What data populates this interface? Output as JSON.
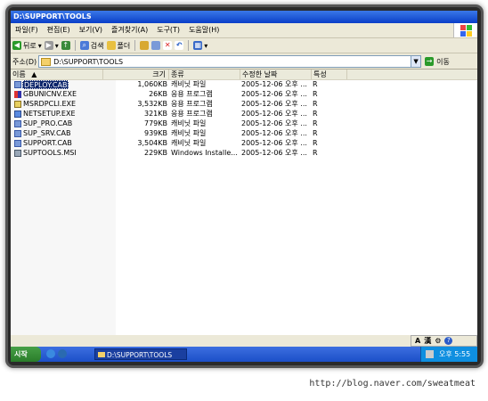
{
  "window": {
    "title": "D:\\SUPPORT\\TOOLS"
  },
  "menu": [
    "파일(F)",
    "편집(E)",
    "보기(V)",
    "즐겨찾기(A)",
    "도구(T)",
    "도움말(H)"
  ],
  "toolbar": {
    "back_label": "뒤로",
    "search_label": "검색",
    "folders_label": "폴더"
  },
  "address": {
    "label": "주소(D)",
    "value": "D:\\SUPPORT\\TOOLS",
    "go_label": "이동"
  },
  "columns": {
    "name": "이름",
    "size": "크기",
    "type": "종류",
    "date": "수정한 날짜",
    "attr": "특성"
  },
  "files": [
    {
      "name": "DEPLOY.CAB",
      "size": "1,060KB",
      "type": "캐비닛 파일",
      "date": "2005-12-06 오후 ...",
      "attr": "R",
      "selected": true,
      "icon": "cab-icon"
    },
    {
      "name": "GBUNICNV.EXE",
      "size": "26KB",
      "type": "응용 프로그램",
      "date": "2005-12-06 오후 ...",
      "attr": "R",
      "icon": "exe-icon"
    },
    {
      "name": "MSRDPCLI.EXE",
      "size": "3,532KB",
      "type": "응용 프로그램",
      "date": "2005-12-06 오후 ...",
      "attr": "R",
      "icon": "exe-icon"
    },
    {
      "name": "NETSETUP.EXE",
      "size": "321KB",
      "type": "응용 프로그램",
      "date": "2005-12-06 오후 ...",
      "attr": "R",
      "icon": "exe-icon"
    },
    {
      "name": "SUP_PRO.CAB",
      "size": "779KB",
      "type": "캐비닛 파일",
      "date": "2005-12-06 오후 ...",
      "attr": "R",
      "icon": "cab-icon"
    },
    {
      "name": "SUP_SRV.CAB",
      "size": "939KB",
      "type": "캐비닛 파일",
      "date": "2005-12-06 오후 ...",
      "attr": "R",
      "icon": "cab-icon"
    },
    {
      "name": "SUPPORT.CAB",
      "size": "3,504KB",
      "type": "캐비닛 파일",
      "date": "2005-12-06 오후 ...",
      "attr": "R",
      "icon": "cab-icon"
    },
    {
      "name": "SUPTOOLS.MSI",
      "size": "229KB",
      "type": "Windows Installe...",
      "date": "2005-12-06 오후 ...",
      "attr": "R",
      "icon": "msi-icon"
    }
  ],
  "langbar": {
    "mode": "A",
    "hanja": "漢"
  },
  "taskbar": {
    "start_label": "시작",
    "task_label": "D:\\SUPPORT\\TOOLS",
    "clock": "오후 5:55"
  },
  "caption": "http://blog.naver.com/sweatmeat",
  "colors": {
    "title_blue": "#0a3fc8",
    "selection": "#0a246a",
    "start_green": "#2a7c2a"
  }
}
